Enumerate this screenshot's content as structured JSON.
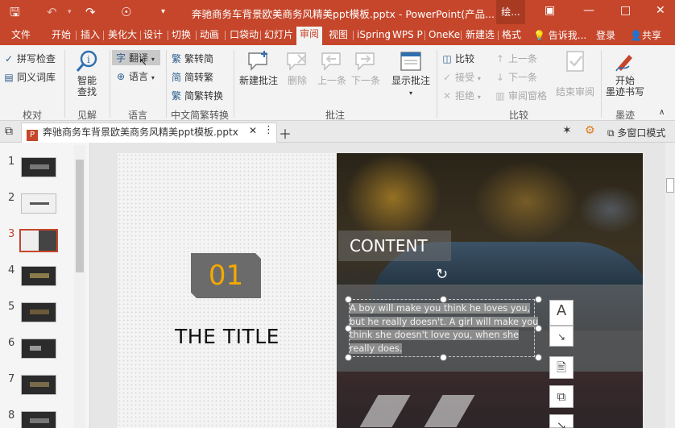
{
  "window": {
    "title": "奔驰商务车背景欧美商务风精美ppt模板.pptx - PowerPoint(产品...",
    "context_tab": "绘...",
    "quick_access": {
      "save": "save-icon",
      "undo": "undo-icon",
      "redo": "redo-icon",
      "present": "present-icon",
      "more": "dropdown-icon"
    }
  },
  "tabs": [
    {
      "label": "文件"
    },
    {
      "label": "开始"
    },
    {
      "label": "插入"
    },
    {
      "label": "美化大"
    },
    {
      "label": "设计"
    },
    {
      "label": "切换"
    },
    {
      "label": "动画"
    },
    {
      "label": "口袋动"
    },
    {
      "label": "幻灯片"
    },
    {
      "label": "审阅"
    },
    {
      "label": "视图"
    },
    {
      "label": "iSpring"
    },
    {
      "label": "WPS P"
    },
    {
      "label": "OneKe"
    },
    {
      "label": "新建选"
    },
    {
      "label": "格式"
    }
  ],
  "tell_me": "告诉我...",
  "login": "登录",
  "share": "共享",
  "ribbon": {
    "proofing": {
      "spell": "拼写检查",
      "thesaurus": "同义词库",
      "group": "校对"
    },
    "insights": {
      "smart_lookup": "智能",
      "smart_lookup2": "查找",
      "group": "见解"
    },
    "language": {
      "translate": "翻译",
      "language": "语言",
      "group": "语言"
    },
    "chinese": {
      "t2s": "繁转简",
      "s2t": "简转繁",
      "convert": "简繁转换",
      "group": "中文简繁转换"
    },
    "comments": {
      "new": "新建批注",
      "delete": "删除",
      "prev": "上一条",
      "next": "下一条",
      "show": "显示批注",
      "group": "批注"
    },
    "compare": {
      "compare": "比较",
      "accept": "接受",
      "reject": "拒绝",
      "prev": "上一条",
      "next": "下一条",
      "pane": "审阅窗格",
      "end": "结束审阅",
      "group": "比较"
    },
    "ink": {
      "start": "开始",
      "start2": "墨迹书写",
      "group": "墨迹"
    }
  },
  "doc_tab": {
    "name": "奔驰商务车背景欧美商务风精美ppt模板.pptx",
    "multi_window": "多窗口模式"
  },
  "thumbnails": [
    {
      "num": "1"
    },
    {
      "num": "2"
    },
    {
      "num": "3"
    },
    {
      "num": "4"
    },
    {
      "num": "5"
    },
    {
      "num": "6"
    },
    {
      "num": "7"
    },
    {
      "num": "8"
    }
  ],
  "slide": {
    "number": "01",
    "title": "THE TITLE",
    "content_label": "CONTENT",
    "body_lines": [
      "A boy will make you think he loves you,",
      "but he really doesn't. A girl will make you",
      "think she doesn't love you, when she",
      "really does."
    ]
  },
  "colors": {
    "accent": "#c5462b",
    "badge_text": "#f5a800",
    "badge_bg": "#6b6b6b"
  }
}
